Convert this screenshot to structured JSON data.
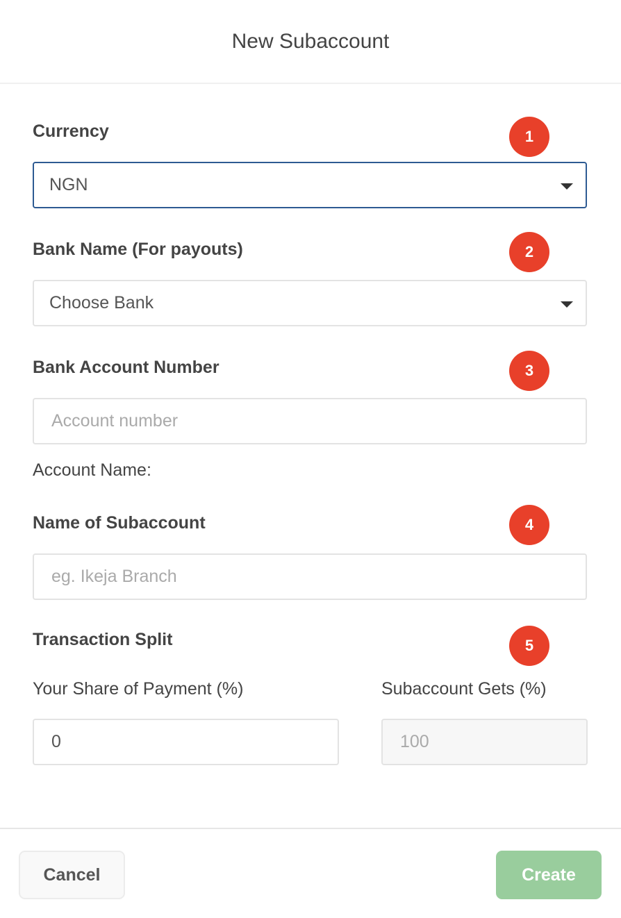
{
  "header": {
    "title": "New Subaccount"
  },
  "form": {
    "currency": {
      "label": "Currency",
      "value": "NGN",
      "step": "1"
    },
    "bank": {
      "label": "Bank Name (For payouts)",
      "value": "Choose Bank",
      "step": "2"
    },
    "account_number": {
      "label": "Bank Account Number",
      "placeholder": "Account number",
      "step": "3"
    },
    "account_name": {
      "label": "Account Name:"
    },
    "subaccount_name": {
      "label": "Name of Subaccount",
      "placeholder": "eg. Ikeja Branch",
      "step": "4"
    },
    "split": {
      "label": "Transaction Split",
      "step": "5",
      "your_share_label": "Your Share of Payment (%)",
      "your_share_value": "0",
      "subaccount_label": "Subaccount Gets (%)",
      "subaccount_value": "100"
    }
  },
  "footer": {
    "cancel": "Cancel",
    "create": "Create"
  },
  "colors": {
    "badge": "#e8402a",
    "create": "#99cd9d",
    "focus": "#2d5a92"
  }
}
